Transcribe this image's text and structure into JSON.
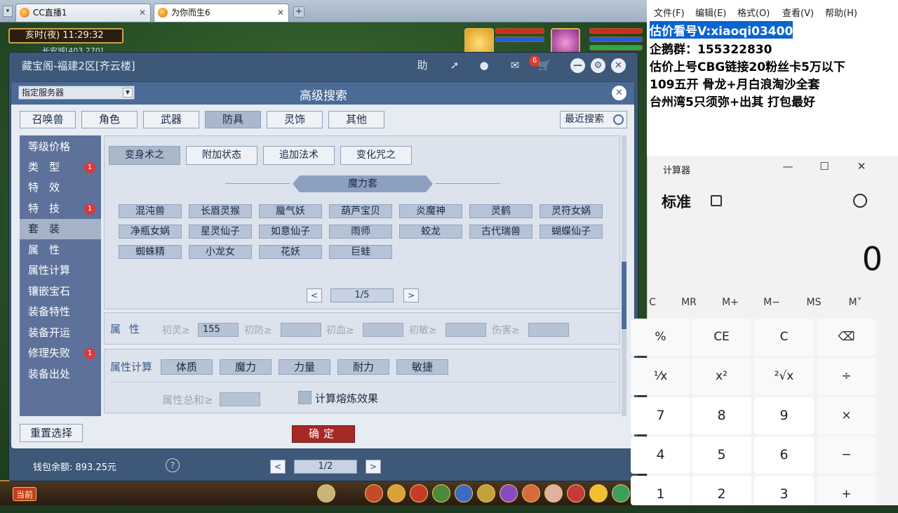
{
  "browser": {
    "tabs": [
      {
        "label": "CC直播1",
        "active": false
      },
      {
        "label": "为你而生6",
        "active": true
      }
    ]
  },
  "game": {
    "clock": "亥时(夜)  11:29:32",
    "location": "长安城[403,270]",
    "current_channel": "当前"
  },
  "cbg": {
    "title": "藏宝阁-福建2区[齐云楼]",
    "icons": [
      "help-icon",
      "share-icon",
      "record-icon",
      "message-icon",
      "cart-icon"
    ],
    "help_label": "助",
    "message_count": "6",
    "wallet": "钱包余额: 893.25元",
    "pager": {
      "prev": "<",
      "page": "1/2",
      "next": ">"
    }
  },
  "search": {
    "server_select": "指定服务器",
    "title": "高级搜索",
    "categories": [
      {
        "label": "召唤兽",
        "selected": false
      },
      {
        "label": "角色",
        "selected": false
      },
      {
        "label": "武器",
        "selected": false
      },
      {
        "label": "防具",
        "selected": true
      },
      {
        "label": "灵饰",
        "selected": false
      },
      {
        "label": "其他",
        "selected": false
      }
    ],
    "recent": "最近搜索",
    "sidebar": [
      {
        "label": "等级价格",
        "badge": "",
        "selected": false
      },
      {
        "label": "类　型",
        "badge": "1",
        "selected": false
      },
      {
        "label": "特　效",
        "badge": "",
        "selected": false
      },
      {
        "label": "特　技",
        "badge": "1",
        "selected": false
      },
      {
        "label": "套　装",
        "badge": "",
        "selected": true
      },
      {
        "label": "属　性",
        "badge": "",
        "selected": false
      },
      {
        "label": "属性计算",
        "badge": "",
        "selected": false
      },
      {
        "label": "镶嵌宝石",
        "badge": "",
        "selected": false
      },
      {
        "label": "装备特性",
        "badge": "",
        "selected": false
      },
      {
        "label": "装备开运",
        "badge": "",
        "selected": false
      },
      {
        "label": "修理失败",
        "badge": "1",
        "selected": false
      },
      {
        "label": "装备出处",
        "badge": "",
        "selected": false
      }
    ],
    "set_tabs": [
      {
        "label": "变身术之",
        "selected": true
      },
      {
        "label": "附加状态",
        "selected": false
      },
      {
        "label": "追加法术",
        "selected": false
      },
      {
        "label": "变化咒之",
        "selected": false
      }
    ],
    "set_group": "魔力套",
    "set_items": [
      "混沌兽",
      "长眉灵猴",
      "蜃气妖",
      "葫芦宝贝",
      "炎魔神",
      "灵鹤",
      "灵符女娲",
      "净瓶女娲",
      "星灵仙子",
      "如意仙子",
      "雨师",
      "蛟龙",
      "古代瑞兽",
      "蝴蝶仙子",
      "蜘蛛精",
      "小龙女",
      "花妖",
      "巨蛙"
    ],
    "set_pager": {
      "prev": "<",
      "page": "1/5",
      "next": ">"
    },
    "attributes": {
      "title": "属性",
      "fields": [
        {
          "label": "初灵≥",
          "value": "155"
        },
        {
          "label": "初防≥",
          "value": ""
        },
        {
          "label": "初血≥",
          "value": ""
        },
        {
          "label": "初敏≥",
          "value": ""
        },
        {
          "label": "伤害≥",
          "value": ""
        }
      ]
    },
    "attr_calc": {
      "title": "属性计算",
      "options": [
        "体质",
        "魔力",
        "力量",
        "耐力",
        "敏捷"
      ],
      "sum_label": "属性总和≥",
      "refine_label": "计算熔炼效果"
    },
    "reset": "重置选择",
    "confirm": "确定"
  },
  "notepad": {
    "menu": [
      "文件(F)",
      "编辑(E)",
      "格式(O)",
      "查看(V)",
      "帮助(H)"
    ],
    "lines": [
      {
        "text": "估价看号V:xiaoqi03400",
        "highlighted": true
      },
      {
        "text": "企鹅群：155322830",
        "highlighted": false
      },
      {
        "text": "估价上号CBG链接20粉丝卡5万以下",
        "highlighted": false
      },
      {
        "text": "109五开 骨龙+月白浪淘沙全套",
        "highlighted": false
      },
      {
        "text": "台州湾5只须弥+出其 打包最好",
        "highlighted": false
      }
    ]
  },
  "calculator": {
    "app_title": "计算器",
    "mode": "标准",
    "display": "0",
    "memory": [
      "C",
      "MR",
      "M+",
      "M−",
      "MS",
      "M˅"
    ],
    "keys": [
      [
        "%",
        "CE",
        "C",
        "⌫"
      ],
      [
        "¹⁄x",
        "x²",
        "²√x",
        "÷"
      ],
      [
        "7",
        "8",
        "9",
        "×"
      ],
      [
        "4",
        "5",
        "6",
        "−"
      ],
      [
        "1",
        "2",
        "3",
        "+"
      ]
    ]
  },
  "colors": {
    "dialog_header": "#4b6a96",
    "sidebar": "#5d719b",
    "confirm": "#a52a26",
    "highlight": "#0a64d0"
  }
}
